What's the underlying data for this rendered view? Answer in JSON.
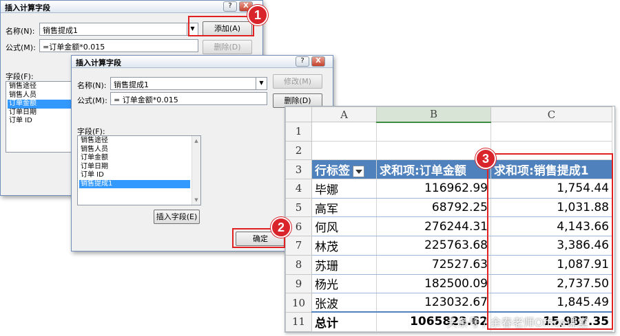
{
  "dialog_back": {
    "title": "插入计算字段",
    "title_help_glyph": "?",
    "title_close_glyph": "X",
    "name_label": "名称(N):",
    "name_value": "销售提成1",
    "formula_label": "公式(M):",
    "formula_value": "=订单金额*0.015",
    "add_button": "添加(A)",
    "delete_button": "删除(D)",
    "fields_label": "字段(F):",
    "fields": [
      "销售途径",
      "销售人员",
      "订单金额",
      "订单日期",
      "订单 ID"
    ],
    "selected_field_index": 2
  },
  "dialog_front": {
    "title": "插入计算字段",
    "title_help_glyph": "?",
    "title_close_glyph": "X",
    "name_label": "名称(N):",
    "name_value": "销售提成1",
    "formula_label": "公式(M):",
    "formula_value": "= 订单金额*0.015",
    "modify_button": "修改(M)",
    "delete_button": "删除(D)",
    "fields_label": "字段(F):",
    "fields": [
      "销售途径",
      "销售人员",
      "订单金额",
      "订单日期",
      "订单 ID",
      "销售提成1"
    ],
    "selected_field_index": 5,
    "insert_field_button": "插入字段(E)",
    "ok_button": "确定"
  },
  "sheet": {
    "columns": [
      "A",
      "B",
      "C"
    ],
    "row_numbers": [
      "1",
      "2",
      "3",
      "4",
      "5",
      "6",
      "7",
      "8",
      "9",
      "10",
      "11"
    ],
    "header": [
      "行标签",
      "求和项:订单金额",
      "求和项:销售提成1"
    ],
    "rows": [
      {
        "name": "毕娜",
        "amount": "116962.99",
        "commission": "1,754.44"
      },
      {
        "name": "高军",
        "amount": "68792.25",
        "commission": "1,031.88"
      },
      {
        "name": "何风",
        "amount": "276244.31",
        "commission": "4,143.66"
      },
      {
        "name": "林茂",
        "amount": "225763.68",
        "commission": "3,386.46"
      },
      {
        "name": "苏珊",
        "amount": "72527.63",
        "commission": "1,087.91"
      },
      {
        "name": "杨光",
        "amount": "182500.09",
        "commission": "2,737.50"
      },
      {
        "name": "张波",
        "amount": "123032.67",
        "commission": "1,845.49"
      }
    ],
    "total": {
      "name": "总计",
      "amount": "1065823.62",
      "commission": "15,987.35"
    }
  },
  "annotations": {
    "badge1": "1",
    "badge2": "2",
    "badge3": "3"
  },
  "colors": {
    "accent_red": "#d8242a",
    "pivot_header": "#4f81bd",
    "selection": "#3399ff"
  },
  "watermark": "头条号 / 余春老师Office课堂"
}
